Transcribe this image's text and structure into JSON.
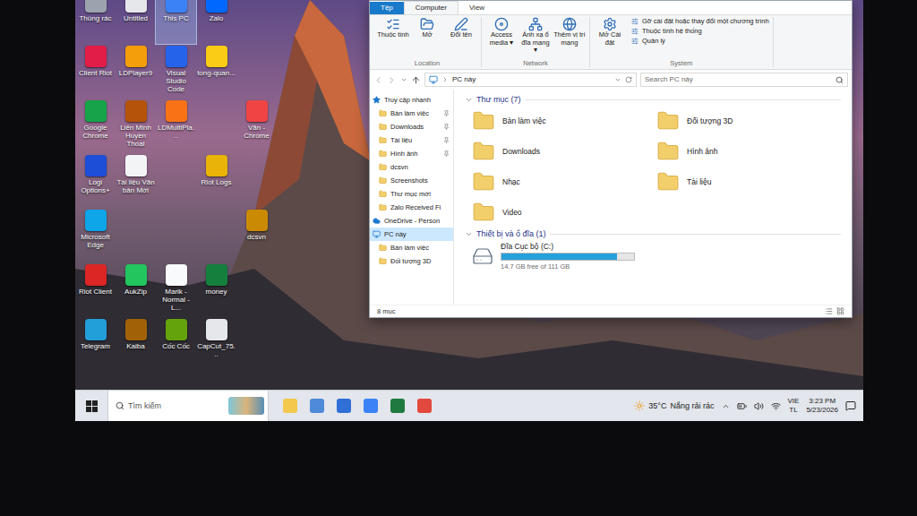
{
  "desktop_icons": [
    {
      "label": "Thùng rác",
      "color": "#9ca3af",
      "selected": false
    },
    {
      "label": "Untitled",
      "color": "#e5e7eb",
      "selected": false
    },
    {
      "label": "This PC",
      "color": "#3b82f6",
      "selected": true
    },
    {
      "label": "Zalo",
      "color": "#0068ff",
      "selected": false
    },
    {
      "label": "Client Riot",
      "color": "#e11d48",
      "selected": false
    },
    {
      "label": "LDPlayer9",
      "color": "#f59e0b",
      "selected": false
    },
    {
      "label": "Visual Studio Code",
      "color": "#2563eb",
      "selected": false
    },
    {
      "label": "tong-quan...",
      "color": "#facc15",
      "selected": false
    },
    {
      "label": "Google Chrome",
      "color": "#16a34a",
      "selected": false
    },
    {
      "label": "Liên Minh Huyền Thoại",
      "color": "#b45309",
      "selected": false
    },
    {
      "label": "LDMultiPla...",
      "color": "#f97316",
      "selected": false
    },
    {
      "label": "Văn - Chrome",
      "color": "#ef4444",
      "selected": false
    },
    {
      "label": "Logi Options+",
      "color": "#1d4ed8",
      "selected": false
    },
    {
      "label": "Tài liệu Văn bản Mới",
      "color": "#f3f4f6",
      "selected": false
    },
    {
      "label": "Riot Logs",
      "color": "#eab308",
      "selected": false
    },
    {
      "label": "Microsoft Edge",
      "color": "#0ea5e9",
      "selected": false
    },
    {
      "label": "dcsvn",
      "color": "#ca8a04",
      "selected": false
    },
    {
      "label": "Riot Client",
      "color": "#dc2626",
      "selected": false
    },
    {
      "label": "AukZip",
      "color": "#22c55e",
      "selected": false
    },
    {
      "label": "Marik - Normal - L...",
      "color": "#f9fafb",
      "selected": false
    },
    {
      "label": "money",
      "color": "#15803d",
      "selected": false
    },
    {
      "label": "Telegram",
      "color": "#229ed9",
      "selected": false
    },
    {
      "label": "Kaiba",
      "color": "#a16207",
      "selected": false
    },
    {
      "label": "Cốc Cốc",
      "color": "#65a30d",
      "selected": false
    },
    {
      "label": "CapCut_75...",
      "color": "#e5e7eb",
      "selected": false
    }
  ],
  "explorer": {
    "tabs": [
      {
        "label": "Tệp",
        "kind": "file",
        "selected": false
      },
      {
        "label": "Computer",
        "kind": "tab",
        "selected": true
      },
      {
        "label": "View",
        "kind": "tab",
        "selected": false
      }
    ],
    "groups": [
      {
        "label": "Location",
        "buttons": [
          "Thuộc tính",
          "Mở",
          "Đổi tên"
        ],
        "links": []
      },
      {
        "label": "Network",
        "buttons": [
          "Access media ▾",
          "Ánh xạ ổ đĩa mạng ▾",
          "Thêm vị trí mạng"
        ],
        "links": []
      },
      {
        "label": "System",
        "buttons": [
          "Mở Cài đặt"
        ],
        "links": [
          "Gỡ cài đặt hoặc thay đổi một chương trình",
          "Thuộc tính hệ thống",
          "Quản lý"
        ]
      }
    ],
    "address": {
      "path": "PC này",
      "search_placeholder": "Search PC này"
    },
    "nav": [
      {
        "label": "Truy cập nhanh",
        "kind": "quick",
        "pinned": false,
        "selected": false
      },
      {
        "label": "Bàn làm việc",
        "kind": "folder",
        "pinned": true,
        "selected": false
      },
      {
        "label": "Downloads",
        "kind": "folder",
        "pinned": true,
        "selected": false
      },
      {
        "label": "Tài liệu",
        "kind": "folder",
        "pinned": true,
        "selected": false
      },
      {
        "label": "Hình ảnh",
        "kind": "folder",
        "pinned": true,
        "selected": false
      },
      {
        "label": "dcsvn",
        "kind": "folder",
        "pinned": false,
        "selected": false
      },
      {
        "label": "Screenshots",
        "kind": "folder",
        "pinned": false,
        "selected": false
      },
      {
        "label": "Thư mục mới",
        "kind": "folder",
        "pinned": false,
        "selected": false
      },
      {
        "label": "Zalo Received Fi",
        "kind": "folder",
        "pinned": false,
        "selected": false
      },
      {
        "label": "OneDrive - Person",
        "kind": "cloud",
        "pinned": false,
        "selected": false
      },
      {
        "label": "PC này",
        "kind": "pc",
        "pinned": false,
        "selected": true
      },
      {
        "label": "Bàn làm việc",
        "kind": "folder",
        "pinned": false,
        "selected": false
      },
      {
        "label": "Đối tượng 3D",
        "kind": "folder",
        "pinned": false,
        "selected": false
      }
    ],
    "folders_section": {
      "title": "Thư mục (7)",
      "expanded": true
    },
    "folders": [
      "Bàn làm việc",
      "Đối tượng 3D",
      "Downloads",
      "Hình ảnh",
      "Nhạc",
      "Tài liệu",
      "Video"
    ],
    "drives_section": {
      "title": "Thiết bị và ổ đĩa (1)",
      "expanded": true
    },
    "drives": [
      {
        "name": "Đĩa Cục bộ (C:)",
        "level": 0.87,
        "free": "14.7 GB free of 111 GB"
      }
    ],
    "status": "8 mục"
  },
  "taskbar": {
    "search_placeholder": "Tìm kiếm",
    "apps": [
      {
        "color": "#f2c94c"
      },
      {
        "color": "#4f8ad9"
      },
      {
        "color": "#2f6fd6"
      },
      {
        "color": "#3b82f6"
      },
      {
        "color": "#1f7a3f"
      },
      {
        "color": "#e2483d"
      }
    ],
    "weather_temp": "35°C",
    "weather_text": "Nắng rải rác",
    "lang": "VIE",
    "layout": "TL",
    "time": "3:23 PM",
    "date": "5/23/2026"
  }
}
